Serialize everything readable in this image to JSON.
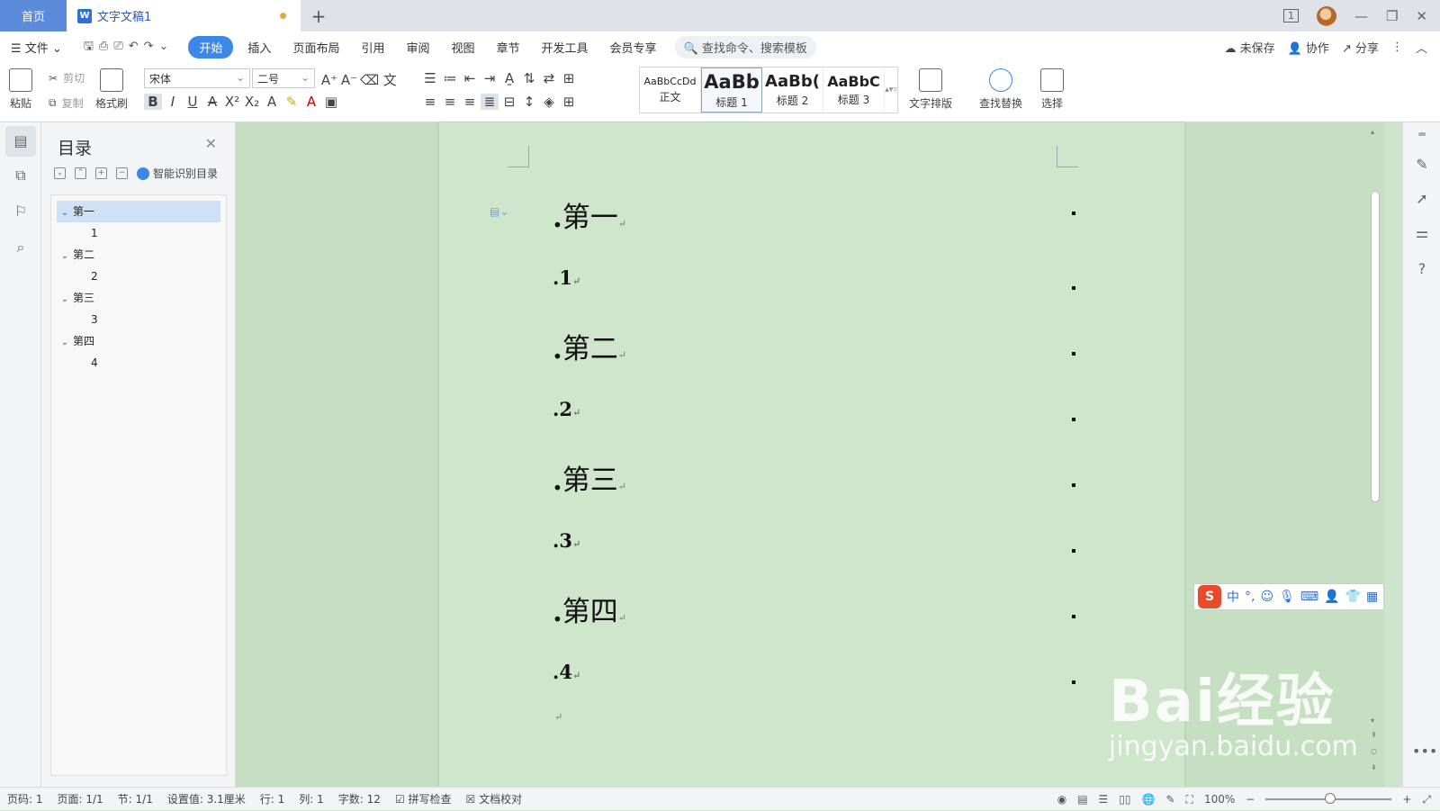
{
  "tabs": {
    "home": "首页",
    "doc": "文字文稿1",
    "add": "+"
  },
  "window": {
    "page_indicator": "1"
  },
  "menu": {
    "file": "文件",
    "items": [
      "开始",
      "插入",
      "页面布局",
      "引用",
      "审阅",
      "视图",
      "章节",
      "开发工具",
      "会员专享"
    ],
    "search_placeholder": "查找命令、搜索模板",
    "unsaved": "未保存",
    "collab": "协作",
    "share": "分享"
  },
  "ribbon": {
    "paste": "粘贴",
    "cut": "剪切",
    "copy": "复制",
    "format_painter": "格式刷",
    "font_name": "宋体",
    "font_size": "二号",
    "styles": [
      {
        "preview": "AaBbCcDd",
        "label": "正文"
      },
      {
        "preview": "AaBb",
        "label": "标题 1"
      },
      {
        "preview": "AaBb(",
        "label": "标题 2"
      },
      {
        "preview": "AaBbC",
        "label": "标题 3"
      }
    ],
    "text_layout": "文字排版",
    "find_replace": "查找替换",
    "select": "选择"
  },
  "toc": {
    "title": "目录",
    "smart": "智能识别目录",
    "items": [
      {
        "label": "第一",
        "child": "1"
      },
      {
        "label": "第二",
        "child": "2"
      },
      {
        "label": "第三",
        "child": "3"
      },
      {
        "label": "第四",
        "child": "4"
      }
    ]
  },
  "document": {
    "lines": [
      "第一",
      "1",
      "第二",
      "2",
      "第三",
      "3",
      "第四",
      "4"
    ]
  },
  "ime": {
    "lang": "中"
  },
  "watermark": {
    "brand": "Bai经验",
    "url": "jingyan.baidu.com"
  },
  "status": {
    "page_num": "页码: 1",
    "pages": "页面: 1/1",
    "section": "节: 1/1",
    "setting": "设置值: 3.1厘米",
    "row": "行: 1",
    "col": "列: 1",
    "words": "字数: 12",
    "spell": "拼写检查",
    "proof": "文档校对",
    "zoom": "100%"
  }
}
